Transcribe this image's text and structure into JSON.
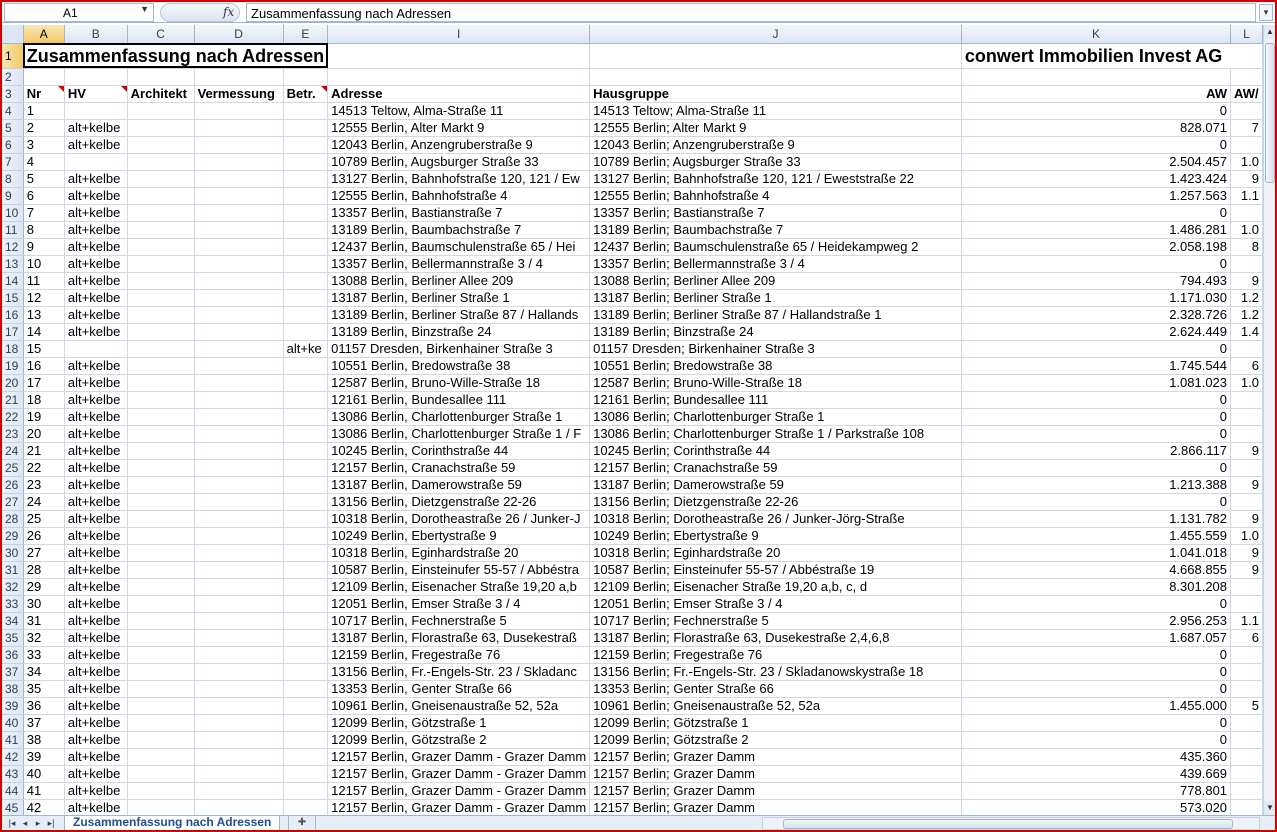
{
  "formula_bar": {
    "cell_ref": "A1",
    "fx": "fx",
    "formula": "Zusammenfassung nach Adressen"
  },
  "columns": [
    "A",
    "B",
    "C",
    "D",
    "E",
    "I",
    "J",
    "K",
    "L"
  ],
  "title": "Zusammenfassung nach Adressen",
  "company": "conwert Immobilien Invest AG",
  "headers": {
    "nr": "Nr",
    "hv": "HV",
    "architekt": "Architekt",
    "vermessung": "Vermessung",
    "betr": "Betr.",
    "adresse": "Adresse",
    "hausgruppe": "Hausgruppe",
    "aw": "AW",
    "aw2": "AW/"
  },
  "rows": [
    {
      "n": "1",
      "hv": "",
      "e": "",
      "adr": "14513 Teltow, Alma-Straße 11",
      "hg": "14513 Teltow; Alma-Straße 11",
      "aw": "0",
      "l": ""
    },
    {
      "n": "2",
      "hv": "alt+kelbe",
      "e": "",
      "adr": "12555 Berlin, Alter Markt 9",
      "hg": "12555 Berlin; Alter Markt 9",
      "aw": "828.071",
      "l": "7"
    },
    {
      "n": "3",
      "hv": "alt+kelbe",
      "e": "",
      "adr": "12043 Berlin, Anzengruberstraße 9",
      "hg": "12043 Berlin; Anzengruberstraße 9",
      "aw": "0",
      "l": ""
    },
    {
      "n": "4",
      "hv": "",
      "e": "",
      "adr": "10789 Berlin, Augsburger Straße 33",
      "hg": "10789 Berlin; Augsburger Straße 33",
      "aw": "2.504.457",
      "l": "1.0"
    },
    {
      "n": "5",
      "hv": "alt+kelbe",
      "e": "",
      "adr": "13127 Berlin, Bahnhofstraße 120, 121 / Ew",
      "hg": "13127 Berlin; Bahnhofstraße 120, 121 / Eweststraße 22",
      "aw": "1.423.424",
      "l": "9"
    },
    {
      "n": "6",
      "hv": "alt+kelbe",
      "e": "",
      "adr": "12555 Berlin, Bahnhofstraße 4",
      "hg": "12555 Berlin; Bahnhofstraße 4",
      "aw": "1.257.563",
      "l": "1.1"
    },
    {
      "n": "7",
      "hv": "alt+kelbe",
      "e": "",
      "adr": "13357 Berlin, Bastianstraße 7",
      "hg": "13357 Berlin; Bastianstraße 7",
      "aw": "0",
      "l": ""
    },
    {
      "n": "8",
      "hv": "alt+kelbe",
      "e": "",
      "adr": "13189 Berlin, Baumbachstraße 7",
      "hg": "13189 Berlin; Baumbachstraße 7",
      "aw": "1.486.281",
      "l": "1.0"
    },
    {
      "n": "9",
      "hv": "alt+kelbe",
      "e": "",
      "adr": "12437 Berlin, Baumschulenstraße 65 / Hei",
      "hg": "12437 Berlin; Baumschulenstraße 65 / Heidekampweg 2",
      "aw": "2.058.198",
      "l": "8"
    },
    {
      "n": "10",
      "hv": "alt+kelbe",
      "e": "",
      "adr": "13357 Berlin, Bellermannstraße 3 / 4",
      "hg": "13357 Berlin; Bellermannstraße 3 / 4",
      "aw": "0",
      "l": ""
    },
    {
      "n": "11",
      "hv": "alt+kelbe",
      "e": "",
      "adr": "13088 Berlin, Berliner Allee 209",
      "hg": "13088 Berlin; Berliner Allee 209",
      "aw": "794.493",
      "l": "9"
    },
    {
      "n": "12",
      "hv": "alt+kelbe",
      "e": "",
      "adr": "13187 Berlin, Berliner Straße 1",
      "hg": "13187 Berlin; Berliner Straße 1",
      "aw": "1.171.030",
      "l": "1.2"
    },
    {
      "n": "13",
      "hv": "alt+kelbe",
      "e": "",
      "adr": "13189 Berlin, Berliner Straße 87 / Hallands",
      "hg": "13189 Berlin; Berliner Straße 87 / Hallandstraße 1",
      "aw": "2.328.726",
      "l": "1.2"
    },
    {
      "n": "14",
      "hv": "alt+kelbe",
      "e": "",
      "adr": "13189 Berlin, Binzstraße 24",
      "hg": "13189 Berlin; Binzstraße 24",
      "aw": "2.624.449",
      "l": "1.4"
    },
    {
      "n": "15",
      "hv": "",
      "e": "alt+ke",
      "adr": "01157 Dresden, Birkenhainer Straße 3",
      "hg": "01157 Dresden; Birkenhainer Straße 3",
      "aw": "0",
      "l": ""
    },
    {
      "n": "16",
      "hv": "alt+kelbe",
      "e": "",
      "adr": "10551 Berlin, Bredowstraße 38",
      "hg": "10551 Berlin; Bredowstraße 38",
      "aw": "1.745.544",
      "l": "6"
    },
    {
      "n": "17",
      "hv": "alt+kelbe",
      "e": "",
      "adr": "12587 Berlin, Bruno-Wille-Straße 18",
      "hg": "12587 Berlin; Bruno-Wille-Straße 18",
      "aw": "1.081.023",
      "l": "1.0"
    },
    {
      "n": "18",
      "hv": "alt+kelbe",
      "e": "",
      "adr": "12161 Berlin, Bundesallee 111",
      "hg": "12161 Berlin; Bundesallee 111",
      "aw": "0",
      "l": ""
    },
    {
      "n": "19",
      "hv": "alt+kelbe",
      "e": "",
      "adr": "13086 Berlin, Charlottenburger Straße 1",
      "hg": "13086 Berlin; Charlottenburger Straße 1",
      "aw": "0",
      "l": ""
    },
    {
      "n": "20",
      "hv": "alt+kelbe",
      "e": "",
      "adr": "13086 Berlin, Charlottenburger Straße 1 / F",
      "hg": "13086 Berlin; Charlottenburger Straße 1 / Parkstraße 108",
      "aw": "0",
      "l": ""
    },
    {
      "n": "21",
      "hv": "alt+kelbe",
      "e": "",
      "adr": "10245 Berlin, Corinthstraße 44",
      "hg": "10245 Berlin; Corinthstraße 44",
      "aw": "2.866.117",
      "l": "9"
    },
    {
      "n": "22",
      "hv": "alt+kelbe",
      "e": "",
      "adr": "12157 Berlin, Cranachstraße 59",
      "hg": "12157 Berlin; Cranachstraße 59",
      "aw": "0",
      "l": ""
    },
    {
      "n": "23",
      "hv": "alt+kelbe",
      "e": "",
      "adr": "13187 Berlin, Damerowstraße 59",
      "hg": "13187 Berlin; Damerowstraße 59",
      "aw": "1.213.388",
      "l": "9"
    },
    {
      "n": "24",
      "hv": "alt+kelbe",
      "e": "",
      "adr": "13156 Berlin, Dietzgenstraße 22-26",
      "hg": "13156 Berlin; Dietzgenstraße 22-26",
      "aw": "0",
      "l": ""
    },
    {
      "n": "25",
      "hv": "alt+kelbe",
      "e": "",
      "adr": "10318 Berlin, Dorotheastraße 26 / Junker-J",
      "hg": "10318 Berlin; Dorotheastraße 26 / Junker-Jörg-Straße",
      "aw": "1.131.782",
      "l": "9"
    },
    {
      "n": "26",
      "hv": "alt+kelbe",
      "e": "",
      "adr": "10249 Berlin, Ebertystraße 9",
      "hg": "10249 Berlin; Ebertystraße 9",
      "aw": "1.455.559",
      "l": "1.0"
    },
    {
      "n": "27",
      "hv": "alt+kelbe",
      "e": "",
      "adr": "10318 Berlin, Eginhardstraße 20",
      "hg": "10318 Berlin; Eginhardstraße 20",
      "aw": "1.041.018",
      "l": "9"
    },
    {
      "n": "28",
      "hv": "alt+kelbe",
      "e": "",
      "adr": "10587 Berlin, Einsteinufer 55-57 / Abbéstra",
      "hg": "10587 Berlin; Einsteinufer 55-57 / Abbéstraße 19",
      "aw": "4.668.855",
      "l": "9"
    },
    {
      "n": "29",
      "hv": "alt+kelbe",
      "e": "",
      "adr": "12109 Berlin, Eisenacher Straße 19,20 a,b",
      "hg": "12109 Berlin; Eisenacher Straße 19,20 a,b, c, d",
      "aw": "8.301.208",
      "l": ""
    },
    {
      "n": "30",
      "hv": "alt+kelbe",
      "e": "",
      "adr": "12051 Berlin, Emser Straße 3 / 4",
      "hg": "12051 Berlin; Emser Straße 3 / 4",
      "aw": "0",
      "l": ""
    },
    {
      "n": "31",
      "hv": "alt+kelbe",
      "e": "",
      "adr": "10717 Berlin, Fechnerstraße 5",
      "hg": "10717 Berlin; Fechnerstraße 5",
      "aw": "2.956.253",
      "l": "1.1"
    },
    {
      "n": "32",
      "hv": "alt+kelbe",
      "e": "",
      "adr": "13187 Berlin, Florastraße 63, Dusekestraß",
      "hg": "13187 Berlin; Florastraße 63, Dusekestraße 2,4,6,8",
      "aw": "1.687.057",
      "l": "6"
    },
    {
      "n": "33",
      "hv": "alt+kelbe",
      "e": "",
      "adr": "12159 Berlin, Fregestraße 76",
      "hg": "12159 Berlin; Fregestraße 76",
      "aw": "0",
      "l": ""
    },
    {
      "n": "34",
      "hv": "alt+kelbe",
      "e": "",
      "adr": "13156 Berlin, Fr.-Engels-Str. 23 / Skladanc",
      "hg": "13156 Berlin; Fr.-Engels-Str. 23 / Skladanowskystraße 18",
      "aw": "0",
      "l": ""
    },
    {
      "n": "35",
      "hv": "alt+kelbe",
      "e": "",
      "adr": "13353 Berlin, Genter Straße 66",
      "hg": "13353 Berlin; Genter Straße 66",
      "aw": "0",
      "l": ""
    },
    {
      "n": "36",
      "hv": "alt+kelbe",
      "e": "",
      "adr": "10961 Berlin, Gneisenaustraße 52, 52a",
      "hg": "10961 Berlin; Gneisenaustraße 52, 52a",
      "aw": "1.455.000",
      "l": "5"
    },
    {
      "n": "37",
      "hv": "alt+kelbe",
      "e": "",
      "adr": "12099 Berlin, Götzstraße 1",
      "hg": "12099 Berlin; Götzstraße 1",
      "aw": "0",
      "l": ""
    },
    {
      "n": "38",
      "hv": "alt+kelbe",
      "e": "",
      "adr": "12099 Berlin, Götzstraße 2",
      "hg": "12099 Berlin; Götzstraße 2",
      "aw": "0",
      "l": ""
    },
    {
      "n": "39",
      "hv": "alt+kelbe",
      "e": "",
      "adr": "12157 Berlin, Grazer Damm - Grazer Damm",
      "hg": "12157 Berlin; Grazer Damm",
      "aw": "435.360",
      "l": ""
    },
    {
      "n": "40",
      "hv": "alt+kelbe",
      "e": "",
      "adr": "12157 Berlin, Grazer Damm - Grazer Damm",
      "hg": "12157 Berlin; Grazer Damm",
      "aw": "439.669",
      "l": ""
    },
    {
      "n": "41",
      "hv": "alt+kelbe",
      "e": "",
      "adr": "12157 Berlin, Grazer Damm - Grazer Damm",
      "hg": "12157 Berlin; Grazer Damm",
      "aw": "778.801",
      "l": ""
    },
    {
      "n": "42",
      "hv": "alt+kelbe",
      "e": "",
      "adr": "12157 Berlin, Grazer Damm - Grazer Damm",
      "hg": "12157 Berlin; Grazer Damm",
      "aw": "573.020",
      "l": ""
    }
  ],
  "sheet_tab": "Zusammenfassung nach Adressen"
}
